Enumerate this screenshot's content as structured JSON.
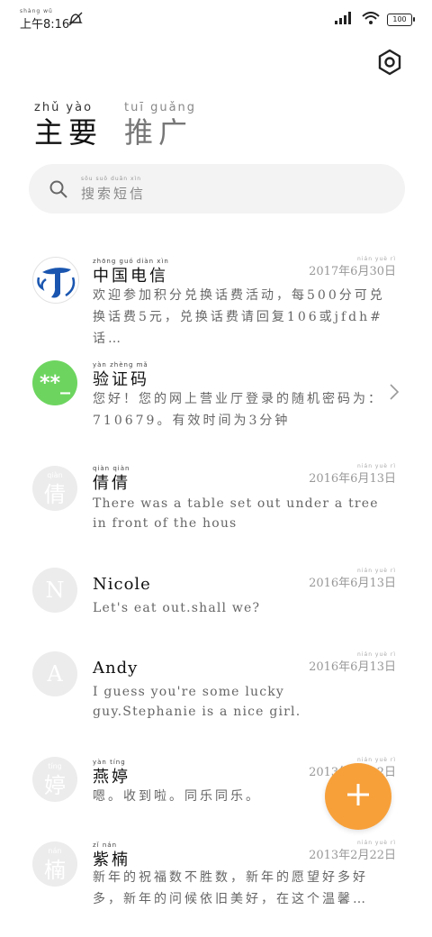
{
  "status_bar": {
    "time": "上午8:16",
    "time_pinyin": "shàng wǔ",
    "battery": "100"
  },
  "tabs": [
    {
      "pinyin": "zhǔ yào",
      "label": "主要"
    },
    {
      "pinyin": "tuī guǎng",
      "label": "推广"
    }
  ],
  "search": {
    "placeholder": "搜索短信",
    "placeholder_pinyin": "sōu suǒ duǎn xìn"
  },
  "messages": [
    {
      "name": "中国电信",
      "name_pinyin": "zhōng guó diàn xìn",
      "date": "2017年6月30日",
      "date_pinyin": "nián yuè rì",
      "preview": "欢迎参加积分兑换话费活动，每500分可兑换话费5元，兑换话费请回复106或jfdh#话…",
      "avatar": "china-telecom-logo"
    },
    {
      "name": "验证码",
      "name_pinyin": "yàn zhèng mǎ",
      "date": "",
      "preview": "您好！您的网上营业厅登录的随机密码为：710679。有效时间为3分钟",
      "avatar_text": "**_"
    },
    {
      "name": "倩倩",
      "name_pinyin": "qiàn qiàn",
      "date": "2016年6月13日",
      "date_pinyin": "nián yuè rì",
      "preview": "There was a table set out under a tree in front of the hous",
      "avatar_text": "倩",
      "avatar_pinyin": "qiàn"
    },
    {
      "name": "Nicole",
      "date": "2016年6月13日",
      "date_pinyin": "nián yuè rì",
      "preview": "Let's eat out.shall we?",
      "avatar_text": "N"
    },
    {
      "name": "Andy",
      "date": "2016年6月13日",
      "date_pinyin": "nián yuè rì",
      "preview": "I guess you're some lucky guy.Stephanie is a nice girl.",
      "avatar_text": "A"
    },
    {
      "name": "燕婷",
      "name_pinyin": "yàn tíng",
      "date": "2013年2月22日",
      "date_pinyin": "nián yuè rì",
      "preview": "嗯。收到啦。同乐同乐。",
      "avatar_text": "婷",
      "avatar_pinyin": "tíng"
    },
    {
      "name": "紫楠",
      "name_pinyin": "zǐ nán",
      "date": "2013年2月22日",
      "date_pinyin": "nián yuè rì",
      "preview": "新年的祝福数不胜数，新年的愿望好多好多，新年的问候依旧美好，在这个温馨…",
      "avatar_text": "楠",
      "avatar_pinyin": "nán"
    }
  ],
  "colors": {
    "accent": "#f7a03a",
    "verify_green": "#6dd55f",
    "telecom_blue": "#1a56b0"
  },
  "fab": {
    "icon": "plus-icon"
  }
}
